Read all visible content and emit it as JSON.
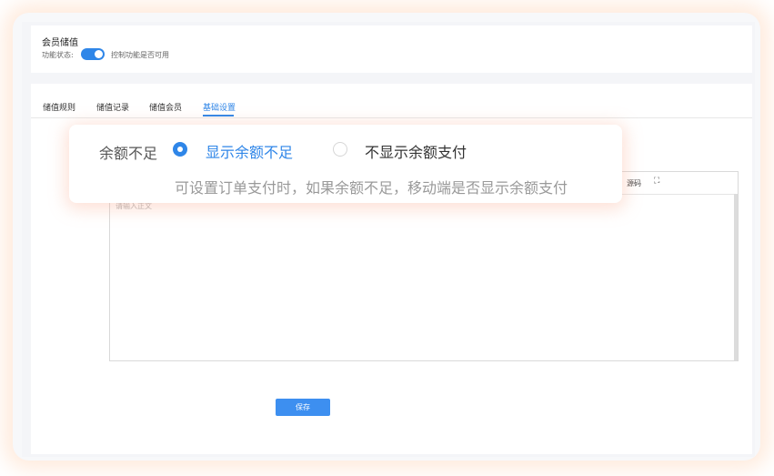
{
  "header": {
    "title": "会员储值",
    "status_label": "功能状态:",
    "toggle_on": true,
    "status_desc": "控制功能是否可用"
  },
  "tabs": [
    {
      "label": "储值规则",
      "active": false
    },
    {
      "label": "储值记录",
      "active": false
    },
    {
      "label": "储值会员",
      "active": false
    },
    {
      "label": "基础设置",
      "active": true
    }
  ],
  "editor": {
    "toolbar_source": "源码",
    "toolbar_fullscreen_icon": "fullscreen-icon",
    "placeholder": "请输入正文"
  },
  "actions": {
    "save_label": "保存"
  },
  "popup": {
    "label": "余额不足",
    "option_show": "显示余额不足",
    "option_hide": "不显示余额支付",
    "selected": "option_show",
    "hint": "可设置订单支付时，如果余额不足，移动端是否显示余额支付"
  },
  "colors": {
    "accent": "#2f86e8",
    "button": "#3d8ff0"
  }
}
